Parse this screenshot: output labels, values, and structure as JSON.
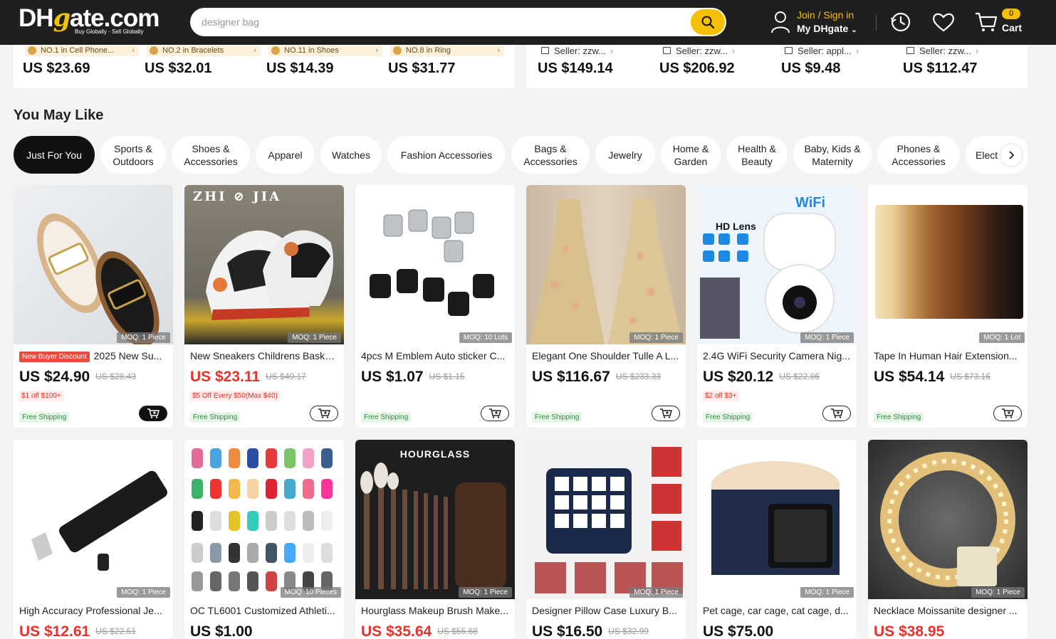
{
  "header": {
    "logo_dh": "DH",
    "logo_g": "g",
    "logo_rest": "ate.com",
    "logo_tagline": "Buy Globally · Sell Globally",
    "search_placeholder": "designer bag",
    "join": "Join / Sign in",
    "my_dhgate": "My DHgate",
    "cart_count": "0",
    "cart_label": "Cart"
  },
  "top_strip_left": [
    {
      "rank": "NO.1 in Cell Phone...",
      "price": "US $23.69"
    },
    {
      "rank": "NO.2 in Bracelets",
      "price": "US $32.01"
    },
    {
      "rank": "NO.11 in Shoes",
      "price": "US $14.39"
    },
    {
      "rank": "NO.8 in Ring",
      "price": "US $31.77"
    }
  ],
  "top_strip_right": [
    {
      "seller": "Seller: zzw...",
      "price": "US $149.14"
    },
    {
      "seller": "Seller: zzw...",
      "price": "US $206.92"
    },
    {
      "seller": "Seller: appl...",
      "price": "US $9.48"
    },
    {
      "seller": "Seller: zzw...",
      "price": "US $112.47"
    }
  ],
  "you_may_like": "You May Like",
  "categories": [
    "Just For You",
    "Sports & Outdoors",
    "Shoes & Accessories",
    "Apparel",
    "Watches",
    "Fashion Accessories",
    "Bags & Accessories",
    "Jewelry",
    "Home & Garden",
    "Health & Beauty",
    "Baby, Kids & Maternity",
    "Phones & Accessories",
    "Elect"
  ],
  "row1": [
    {
      "badge": "New Buyer Discount",
      "title": "2025 New Su...",
      "price": "US $24.90",
      "old": "US $28.43",
      "promo": "$1 off $100+",
      "ship": "Free Shipping",
      "moq": "MOQ: 1 Piece"
    },
    {
      "title": "New Sneakers Childrens Baske...",
      "price": "US $23.11",
      "old": "US $49.17",
      "promo": "$5 Off Every $50(Max $40)",
      "ship": "Free Shipping",
      "moq": "MOQ: 1 Piece",
      "brand": "ZHI ⊘ JIA"
    },
    {
      "title": "4pcs M Emblem Auto sticker C...",
      "price": "US $1.07",
      "old": "US $1.15",
      "ship": "Free Shipping",
      "moq": "MOQ: 10 Lots"
    },
    {
      "title": "Elegant One Shoulder Tulle A L...",
      "price": "US $116.67",
      "old": "US $233.33",
      "ship": "Free Shipping",
      "moq": "MOQ: 1 Piece"
    },
    {
      "title": "2.4G WiFi Security Camera Nig...",
      "price": "US $20.12",
      "old": "US $22.86",
      "promo": "$2 off $3+",
      "ship": "Free Shipping",
      "moq": "MOQ: 1 Piece",
      "wifi": "WiFi",
      "hd": "HD Lens"
    },
    {
      "title": "Tape In Human Hair Extension...",
      "price": "US $54.14",
      "old": "US $73.16",
      "ship": "Free Shipping",
      "moq": "MOQ: 1 Lot"
    }
  ],
  "row2": [
    {
      "title": "High Accuracy Professional Je...",
      "price": "US $12.61",
      "old": "US $22.51",
      "moq": "MOQ: 1 Piece"
    },
    {
      "title": "OC TL6001 Customized Athleti...",
      "price": "US $1.00",
      "moq": "MOQ: 10 Pieces"
    },
    {
      "title": "Hourglass Makeup Brush Make...",
      "price": "US $35.64",
      "old": "US $55.68",
      "moq": "MOQ: 1 Piece",
      "brand": "HOURGLASS"
    },
    {
      "title": "Designer Pillow Case Luxury B...",
      "price": "US $16.50",
      "old": "US $32.99",
      "moq": "MOQ: 1 Piece"
    },
    {
      "title": "Pet cage, car cage, cat cage, d...",
      "price": "US $75.00",
      "moq": "MOQ: 1 Piece"
    },
    {
      "title": "Necklace Moissanite designer ...",
      "price": "US $38.95",
      "moq": "MOQ: 1 Piece"
    }
  ]
}
